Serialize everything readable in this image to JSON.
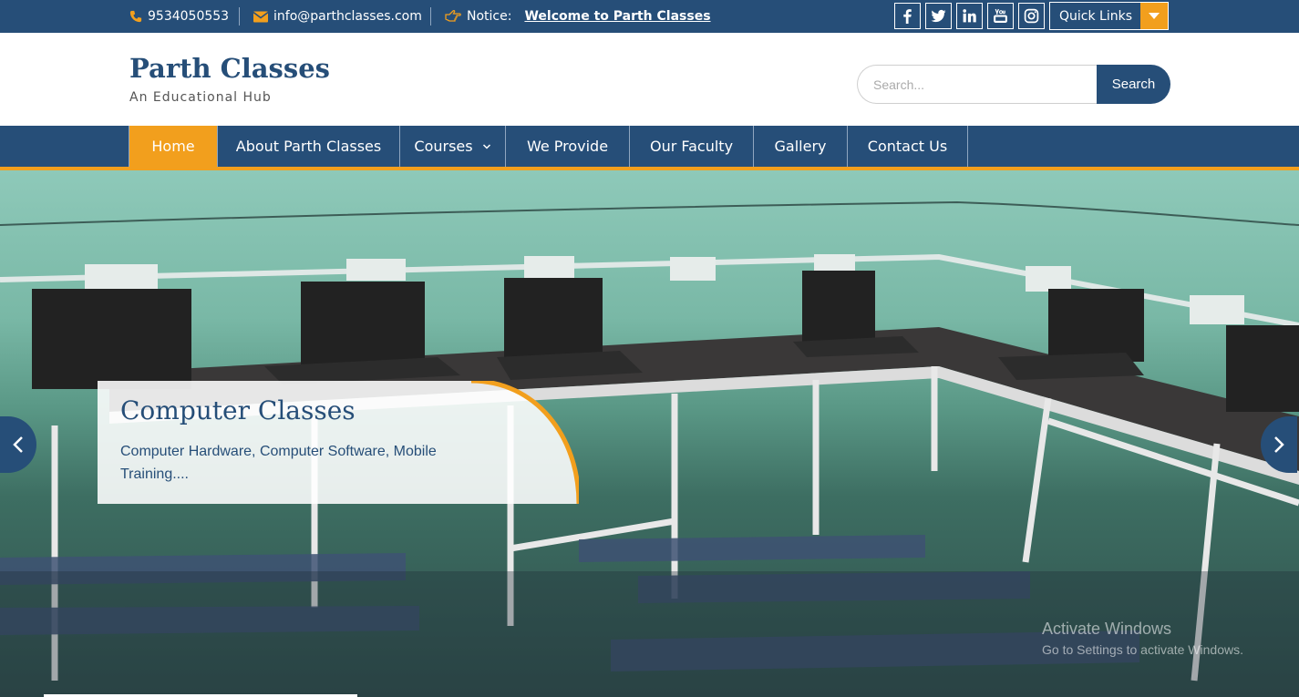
{
  "topbar": {
    "phone": "9534050553",
    "email": "info@parthclasses.com",
    "notice_label": "Notice:",
    "notice_text": "Welcome to Parth Classes",
    "social_icons": [
      "facebook-icon",
      "twitter-icon",
      "linkedin-icon",
      "youtube-icon",
      "instagram-icon"
    ],
    "quick_links_label": "Quick Links"
  },
  "header": {
    "site_title": "Parth Classes",
    "tagline": "An Educational Hub"
  },
  "search": {
    "placeholder": "Search...",
    "button_label": "Search"
  },
  "nav": {
    "items": [
      {
        "label": "Home",
        "active": true
      },
      {
        "label": "About Parth Classes"
      },
      {
        "label": "Courses",
        "has_dropdown": true
      },
      {
        "label": "We Provide"
      },
      {
        "label": "Our Faculty"
      },
      {
        "label": "Gallery"
      },
      {
        "label": "Contact Us"
      }
    ]
  },
  "slider": {
    "title": "Computer Classes",
    "text": "Computer Hardware, Computer Software, Mobile Training....",
    "prev_icon": "chevron-left-icon",
    "next_icon": "chevron-right-icon"
  },
  "watermark": {
    "title": "Activate Windows",
    "subtitle": "Go to Settings to activate Windows."
  },
  "colors": {
    "primary": "#264e78",
    "accent": "#f29f1d",
    "white": "#ffffff"
  }
}
